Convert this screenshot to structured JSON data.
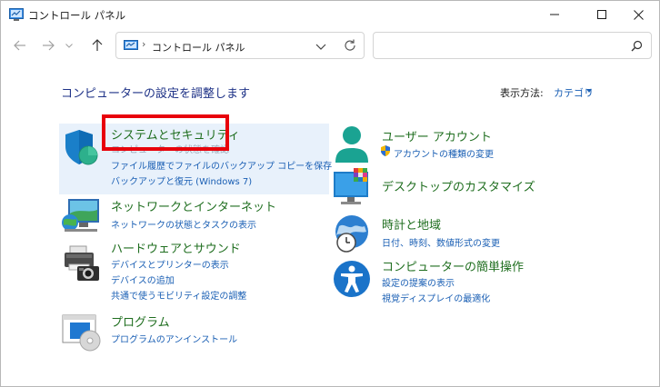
{
  "window": {
    "title": "コントロール パネル"
  },
  "address_bar": {
    "separator": "›",
    "path": "コントロール パネル"
  },
  "search": {
    "placeholder": ""
  },
  "content": {
    "heading": "コンピューターの設定を調整します",
    "view_by_label": "表示方法:",
    "view_by_value": "カテゴリ"
  },
  "categories": {
    "system_security": {
      "title": "システムとセキュリティ",
      "links": [
        "コンピューターの状態を確認",
        "ファイル履歴でファイルのバックアップ コピーを保存",
        "バックアップと復元 (Windows 7)"
      ]
    },
    "network": {
      "title": "ネットワークとインターネット",
      "links": [
        "ネットワークの状態とタスクの表示"
      ]
    },
    "hardware": {
      "title": "ハードウェアとサウンド",
      "links": [
        "デバイスとプリンターの表示",
        "デバイスの追加",
        "共通で使うモビリティ設定の調整"
      ]
    },
    "programs": {
      "title": "プログラム",
      "links": [
        "プログラムのアンインストール"
      ]
    },
    "user_accounts": {
      "title": "ユーザー アカウント",
      "links": [
        "アカウントの種類の変更"
      ]
    },
    "appearance": {
      "title": "デスクトップのカスタマイズ",
      "links": []
    },
    "clock_region": {
      "title": "時計と地域",
      "links": [
        "日付、時刻、数値形式の変更"
      ]
    },
    "ease_of_access": {
      "title": "コンピューターの簡単操作",
      "links": [
        "設定の提案の表示",
        "視覚ディスプレイの最適化"
      ]
    }
  },
  "colors": {
    "category_title": "#1f6e1f",
    "link": "#1a5fb4",
    "heading": "#1e3287",
    "highlight": "#e8000b",
    "selected_bg": "#e8f1fb"
  }
}
